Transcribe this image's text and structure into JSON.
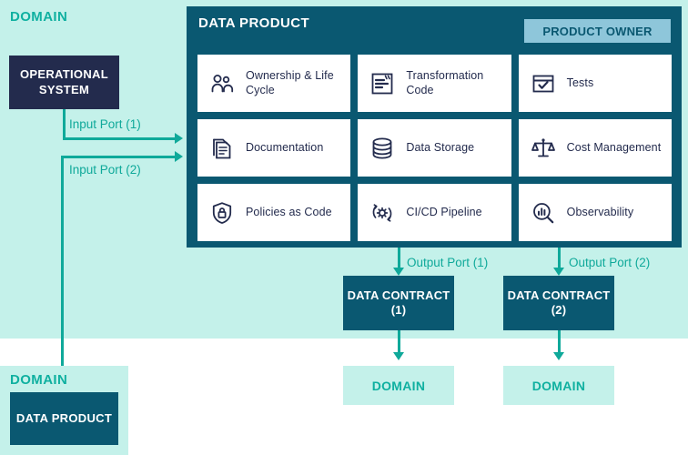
{
  "domains": {
    "top_label": "DOMAIN",
    "bottom_label": "DOMAIN",
    "consumer_1_label": "DOMAIN",
    "consumer_2_label": "DOMAIN"
  },
  "operational_system": {
    "label": "OPERATIONAL SYSTEM"
  },
  "bottom_data_product": {
    "label": "DATA PRODUCT"
  },
  "data_product": {
    "title": "DATA PRODUCT",
    "product_owner_badge": "PRODUCT OWNER",
    "cards": [
      {
        "label": "Ownership & Life Cycle",
        "icon": "people-icon"
      },
      {
        "label": "Transformation Code",
        "icon": "code-document-icon"
      },
      {
        "label": "Tests",
        "icon": "checklist-icon"
      },
      {
        "label": "Documentation",
        "icon": "documents-icon"
      },
      {
        "label": "Data Storage",
        "icon": "database-icon"
      },
      {
        "label": "Cost Management",
        "icon": "balance-scale-icon"
      },
      {
        "label": "Policies as Code",
        "icon": "shield-lock-icon"
      },
      {
        "label": "CI/CD Pipeline",
        "icon": "gear-cycle-icon"
      },
      {
        "label": "Observability",
        "icon": "magnifier-chart-icon"
      }
    ]
  },
  "ports": {
    "input_1": "Input Port (1)",
    "input_2": "Input Port (2)",
    "output_1": "Output Port (1)",
    "output_2": "Output Port (2)"
  },
  "contracts": {
    "contract_1": "DATA CONTRACT (1)",
    "contract_2": "DATA CONTRACT (2)"
  },
  "colors": {
    "domain_bg": "#c4f1ea",
    "teal_accent": "#0fa99a",
    "panel_dark": "#0a5871",
    "navy": "#232b4d",
    "badge": "#8ec6da",
    "card_bg": "#ffffff"
  }
}
